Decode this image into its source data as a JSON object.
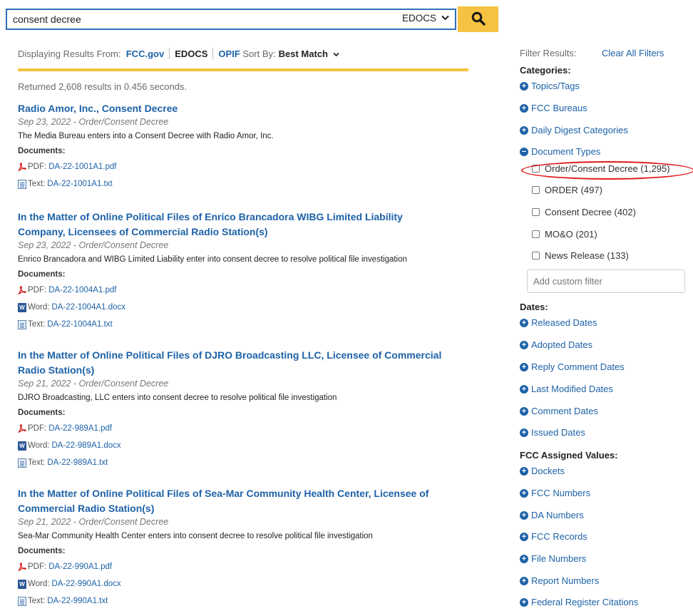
{
  "search": {
    "query": "consent decree",
    "source_selected": "EDOCS",
    "button_icon": "search-icon"
  },
  "results_header": {
    "displaying_label": "Displaying Results From:",
    "sources": [
      "FCC.gov",
      "EDOCS",
      "OPIF"
    ],
    "active_source": "EDOCS",
    "sort_label": "Sort By:",
    "sort_value": "Best Match",
    "returned_text": "Returned 2,608 results in 0.456 seconds.",
    "accent_color": "#f5c242"
  },
  "results": [
    {
      "title": "Radio Amor, Inc., Consent Decree",
      "title_line2": "",
      "date": "Sep 23, 2022 - Order/Consent Decree",
      "description": "The Media Bureau enters into a Consent Decree with Radio Amor, Inc.",
      "documents_label": "Documents:",
      "docs": [
        {
          "icon": "pdf-icon",
          "type": "PDF:",
          "file": "DA-22-1001A1.pdf"
        },
        {
          "icon": "text-file-icon",
          "type": "Text:",
          "file": "DA-22-1001A1.txt"
        }
      ]
    },
    {
      "title": "In the Matter of Online Political Files of Enrico Brancadora WIBG Limited Liability",
      "title_line2": "Company, Licensees of Commercial Radio Station(s)",
      "date": "Sep 23, 2022 - Order/Consent Decree",
      "description": "Enrico Brancadora and WIBG Limited Liability enter into consent decree to resolve political file investigation",
      "documents_label": "Documents:",
      "docs": [
        {
          "icon": "pdf-icon",
          "type": "PDF:",
          "file": "DA-22-1004A1.pdf"
        },
        {
          "icon": "word-icon",
          "type": "Word:",
          "file": "DA-22-1004A1.docx"
        },
        {
          "icon": "text-file-icon",
          "type": "Text:",
          "file": "DA-22-1004A1.txt"
        }
      ]
    },
    {
      "title": "In the Matter of Online Political Files of DJRO Broadcasting LLC, Licensee of Commercial",
      "title_line2": "Radio Station(s)",
      "date": "Sep 21, 2022 - Order/Consent Decree",
      "description": "DJRO Broadcasting, LLC enters into consent decree to resolve political file investigation",
      "documents_label": "Documents:",
      "docs": [
        {
          "icon": "pdf-icon",
          "type": "PDF:",
          "file": "DA-22-989A1.pdf"
        },
        {
          "icon": "word-icon",
          "type": "Word:",
          "file": "DA-22-989A1.docx"
        },
        {
          "icon": "text-file-icon",
          "type": "Text:",
          "file": "DA-22-989A1.txt"
        }
      ]
    },
    {
      "title": "In the Matter of Online Political Files of Sea-Mar Community Health Center, Licensee of",
      "title_line2": "Commercial Radio Station(s)",
      "date": "Sep 21, 2022 - Order/Consent Decree",
      "description": "Sea-Mar Community Health Center enters into consent decree to resolve political file investigation",
      "documents_label": "Documents:",
      "docs": [
        {
          "icon": "pdf-icon",
          "type": "PDF:",
          "file": "DA-22-990A1.pdf"
        },
        {
          "icon": "word-icon",
          "type": "Word:",
          "file": "DA-22-990A1.docx"
        },
        {
          "icon": "text-file-icon",
          "type": "Text:",
          "file": "DA-22-990A1.txt"
        }
      ]
    }
  ],
  "filters": {
    "header": "Filter Results:",
    "clear_all": "Clear All Filters",
    "categories_title": "Categories:",
    "categories": [
      {
        "label": "Topics/Tags",
        "icon": "plus-circle-icon"
      },
      {
        "label": "FCC Bureaus",
        "icon": "plus-circle-icon"
      },
      {
        "label": "Daily Digest Categories",
        "icon": "plus-circle-icon"
      },
      {
        "label": "Document Types",
        "icon": "minus-circle-icon"
      }
    ],
    "document_types": [
      "Order/Consent Decree (1,295)",
      "ORDER (497)",
      "Consent Decree (402)",
      "MO&O (201)",
      "News Release (133)"
    ],
    "custom_filter_placeholder": "Add custom filter",
    "dates_title": "Dates:",
    "dates": [
      "Released Dates",
      "Adopted Dates",
      "Reply Comment Dates",
      "Last Modified Dates",
      "Comment Dates",
      "Issued Dates"
    ],
    "assigned_title": "FCC Assigned Values:",
    "assigned": [
      "Dockets",
      "FCC Numbers",
      "DA Numbers",
      "FCC Records",
      "File Numbers",
      "Report Numbers",
      "Federal Register Citations"
    ],
    "highlight_color": "#e0191b"
  }
}
